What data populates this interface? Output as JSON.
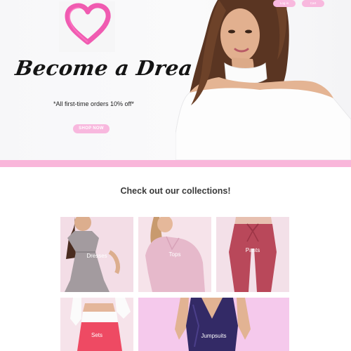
{
  "header": {
    "login_label": "Log in",
    "cart_label": "Cart"
  },
  "hero": {
    "tagline": "Become a Drea Doll",
    "promo": "*All first-time orders 10% off*",
    "cta_label": "SHOP NOW"
  },
  "collections": {
    "title": "Check out our collections!",
    "items": [
      {
        "label": "Dresses"
      },
      {
        "label": "Tops"
      },
      {
        "label": "Pants"
      },
      {
        "label": "Sets"
      },
      {
        "label": "Jumpsuits"
      }
    ]
  },
  "colors": {
    "accent_pink": "#f8b8de",
    "band_pink": "#f9b6da"
  },
  "icons": {
    "logo": "heart-logo-icon"
  }
}
